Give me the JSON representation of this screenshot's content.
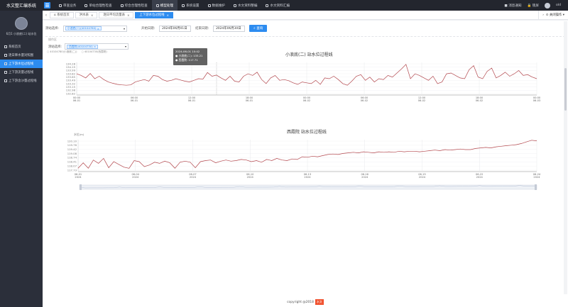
{
  "app": {
    "title": "水文整汇编系统"
  },
  "topnav": [
    {
      "label": "审查业务",
      "active": false
    },
    {
      "label": "单站合理性检查",
      "active": false
    },
    {
      "label": "综合合理性检查",
      "active": false
    },
    {
      "label": "模型处理",
      "active": true
    },
    {
      "label": "系统设置",
      "active": false
    },
    {
      "label": "数据维护",
      "active": false
    },
    {
      "label": "水文资料整编",
      "active": false
    },
    {
      "label": "水文资料汇编",
      "active": false
    }
  ],
  "topright": {
    "notice": "消息通知",
    "lock": "锁屏",
    "user": "old"
  },
  "user": {
    "name": "6月1 小浪底(二) 站水位"
  },
  "sidebar": [
    {
      "label": "系统首页",
      "active": false
    },
    {
      "label": "逐日降水量对照图",
      "active": false
    },
    {
      "label": "上下游水位过程线",
      "active": true
    },
    {
      "label": "上下游流量过程线",
      "active": false
    },
    {
      "label": "上下游含沙量过程线",
      "active": false
    }
  ],
  "tabs": [
    {
      "label": "系统首页",
      "active": false
    },
    {
      "label": "洪水表",
      "active": false
    },
    {
      "label": "逐日平均流量表",
      "active": false
    },
    {
      "label": "上下游水位过程线",
      "active": true
    }
  ],
  "tab_close_all": "关闭操作",
  "filters": {
    "station_label": "测站选择:",
    "station_chip": "小浪底(二)(40104780)",
    "start_label": "开始日期:",
    "start_value": "2024年06月01日",
    "end_label": "结束日期:",
    "end_value": "2024年06月30日",
    "query": "查询"
  },
  "section": {
    "label": "操作区",
    "station_label": "测站选择:",
    "station_chip": "西霞院(40104730)"
  },
  "legend": [
    "40104780(小浪底(二))",
    "40104730(西霞院)"
  ],
  "tooltip": {
    "time": "2024-06-01 10:42",
    "s1_name": "小浪底(二)",
    "s1_value": "133.21",
    "s2_name": "西霞院",
    "s2_value": "117.71"
  },
  "footer": {
    "text": "copyright @2018",
    "badge": "水文"
  },
  "colors": {
    "accent": "#2d8cf0",
    "line": "#b3474d",
    "sidebar": "#2b2f3a",
    "topbar": "#23262e"
  },
  "chart_data": [
    {
      "type": "line",
      "title": "小浪底(二) 站水位过程线",
      "ylim": [
        132.4,
        134.4
      ],
      "yticks": [
        "134.28",
        "134.15",
        "133.99",
        "133.82",
        "133.65",
        "133.49",
        "133.32",
        "133.15",
        "132.98",
        "132.82"
      ],
      "xticks": [
        [
          "00:00",
          "06-01"
        ],
        [
          "06:00",
          "06-01"
        ],
        [
          "12:00",
          "06-01"
        ],
        [
          "18:00",
          "06-01"
        ],
        [
          "00:00",
          "06-02"
        ],
        [
          "06:00",
          "06-02"
        ],
        [
          "12:00",
          "06-02"
        ],
        [
          "18:00",
          "06-02"
        ],
        [
          "00:00",
          "06-03"
        ]
      ],
      "series": [
        {
          "values": [
            133.7,
            133.6,
            133.45,
            133.72,
            133.4,
            133.55,
            133.35,
            133.2,
            133.12,
            133.05,
            133.02,
            133.0,
            133.02,
            133.2,
            133.28,
            133.35,
            133.25,
            133.6,
            133.55,
            133.35,
            133.25,
            133.3,
            133.4,
            133.32,
            133.25,
            133.2,
            133.3,
            133.4,
            133.38,
            133.78,
            133.55,
            133.62,
            133.45,
            133.3,
            133.55,
            133.25,
            133.2,
            133.55,
            133.7,
            133.6,
            133.8,
            133.35,
            133.1,
            133.45,
            133.6,
            133.3,
            133.35,
            133.28,
            133.15,
            133.05,
            133.2,
            133.15,
            133.1,
            133.3,
            133.05,
            133.45,
            133.4,
            133.55,
            133.35,
            133.1,
            133.0,
            133.25,
            133.55,
            133.65,
            133.3,
            133.5,
            133.2,
            133.4,
            133.35,
            133.6,
            133.5,
            133.75,
            134.0,
            134.28,
            133.4,
            133.7,
            133.6,
            133.45,
            133.3,
            133.55,
            133.1,
            133.2,
            133.7,
            133.75,
            133.6,
            133.45,
            133.4,
            133.95,
            134.2,
            133.5,
            133.4,
            133.85,
            134.05,
            133.45,
            133.6,
            133.8,
            133.55,
            133.7,
            133.9,
            133.6,
            133.65,
            133.5,
            133.4
          ]
        }
      ]
    },
    {
      "type": "line",
      "title": "西霞院 站水位过程线",
      "ylabel": "水位(m)",
      "ylim": [
        117.4,
        120.3
      ],
      "yticks": [
        "120.10",
        "119.76",
        "119.42",
        "119.08",
        "118.74",
        "118.41",
        "118.07",
        "117.73"
      ],
      "xticks": [
        [
          "06-01",
          "2024"
        ],
        [
          "06-04",
          "2024"
        ],
        [
          "06-07",
          "2024"
        ],
        [
          "06-10",
          "2024"
        ],
        [
          "06-13",
          "2024"
        ],
        [
          "06-16",
          "2024"
        ],
        [
          "06-19",
          "2024"
        ],
        [
          "06-22",
          "2024"
        ],
        [
          "06-24",
          "2024"
        ]
      ],
      "series": [
        {
          "values": [
            117.7,
            118.2,
            117.7,
            118.45,
            118.15,
            118.6,
            117.75,
            118.3,
            118.05,
            117.8,
            117.7,
            118.4,
            118.3,
            117.85,
            118.0,
            118.25,
            118.15,
            118.35,
            118.2,
            117.7,
            118.25,
            118.35,
            118.25,
            117.75,
            118.3,
            118.4,
            118.45,
            118.2,
            118.35,
            118.45,
            118.35,
            118.4,
            118.5,
            118.45,
            118.3,
            118.4,
            118.25,
            118.5,
            118.4,
            118.6,
            118.45,
            118.4,
            118.55,
            118.5,
            118.75,
            118.7,
            118.8,
            118.75,
            118.85,
            118.95,
            119.0,
            118.95,
            119.05,
            119.1,
            119.15,
            119.1,
            119.2,
            119.15,
            119.1,
            119.2,
            119.15,
            119.2,
            119.15,
            119.25,
            119.2,
            119.25,
            119.25,
            119.2,
            119.25,
            119.3,
            119.35,
            119.3,
            119.4,
            119.35,
            119.4,
            119.45,
            119.4,
            119.4,
            119.5,
            119.55,
            119.6,
            119.55,
            119.65,
            119.7,
            119.75,
            119.8,
            119.85,
            119.95,
            120.1,
            120.25,
            120.2
          ]
        }
      ]
    }
  ]
}
